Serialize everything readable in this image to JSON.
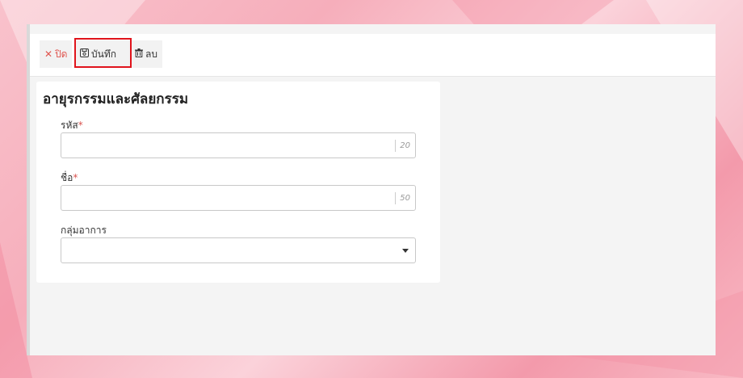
{
  "toolbar": {
    "close_label": "ปิด",
    "save_label": "บันทึก",
    "delete_label": "ลบ"
  },
  "form": {
    "title": "อายุรกรรมและศัลยกรรม",
    "fields": [
      {
        "label": "รหัส",
        "required": true,
        "value": "",
        "max_length": "20"
      },
      {
        "label": "ชื่อ",
        "required": true,
        "value": "",
        "max_length": "50"
      },
      {
        "label": "กลุ่มอาการ",
        "required": false,
        "value": ""
      }
    ]
  },
  "icons": {
    "close": "close-icon",
    "save": "save-icon",
    "delete": "trash-icon",
    "dropdown": "chevron-down-icon"
  },
  "colors": {
    "highlight": "#e0141c",
    "close_accent": "#e0554f",
    "required": "#d9534f"
  }
}
